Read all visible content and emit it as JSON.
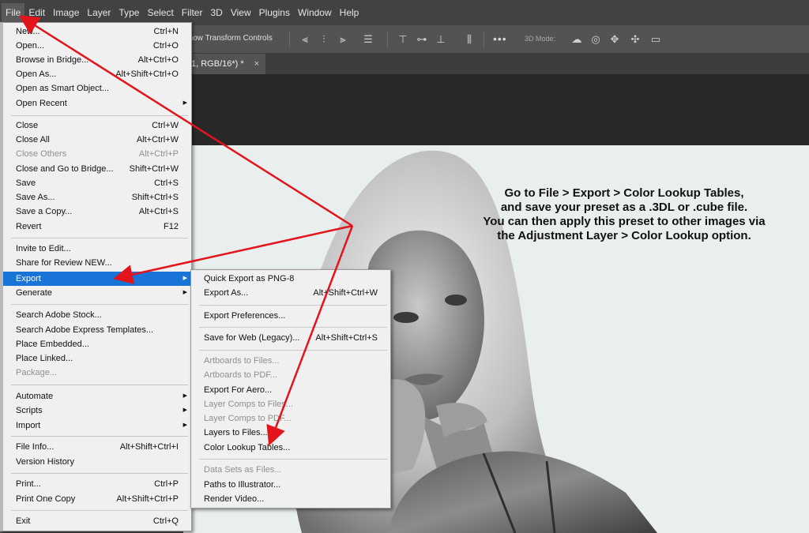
{
  "menubar": {
    "items": [
      "File",
      "Edit",
      "Image",
      "Layer",
      "Type",
      "Select",
      "Filter",
      "3D",
      "View",
      "Plugins",
      "Window",
      "Help"
    ]
  },
  "options_bar": {
    "show_transform_label": "Show Transform Controls",
    "more_label": "•••",
    "mode_3d_label": "3D Mode:"
  },
  "document_tab": {
    "title": "1, RGB/16*) *",
    "close": "×"
  },
  "annotation": {
    "lines": [
      "Go to File > Export > Color Lookup Tables,",
      "and save your preset as a .3DL or .cube file.",
      "You can then apply this preset to other images via",
      "the Adjustment Layer > Color Lookup option."
    ]
  },
  "file_menu": {
    "items": [
      {
        "label": "New...",
        "shortcut": "Ctrl+N"
      },
      {
        "label": "Open...",
        "shortcut": "Ctrl+O"
      },
      {
        "label": "Browse in Bridge...",
        "shortcut": "Alt+Ctrl+O"
      },
      {
        "label": "Open As...",
        "shortcut": "Alt+Shift+Ctrl+O"
      },
      {
        "label": "Open as Smart Object...",
        "shortcut": ""
      },
      {
        "label": "Open Recent",
        "shortcut": "",
        "submenu": true
      },
      {
        "label": "Close",
        "shortcut": "Ctrl+W"
      },
      {
        "label": "Close All",
        "shortcut": "Alt+Ctrl+W"
      },
      {
        "label": "Close Others",
        "shortcut": "Alt+Ctrl+P",
        "disabled": true
      },
      {
        "label": "Close and Go to Bridge...",
        "shortcut": "Shift+Ctrl+W"
      },
      {
        "label": "Save",
        "shortcut": "Ctrl+S"
      },
      {
        "label": "Save As...",
        "shortcut": "Shift+Ctrl+S"
      },
      {
        "label": "Save a Copy...",
        "shortcut": "Alt+Ctrl+S"
      },
      {
        "label": "Revert",
        "shortcut": "F12"
      },
      {
        "label": "Invite to Edit...",
        "shortcut": ""
      },
      {
        "label": "Share for Review NEW...",
        "shortcut": ""
      },
      {
        "label": "Export",
        "shortcut": "",
        "submenu": true,
        "highlighted": true
      },
      {
        "label": "Generate",
        "shortcut": "",
        "submenu": true
      },
      {
        "label": "Search Adobe Stock...",
        "shortcut": ""
      },
      {
        "label": "Search Adobe Express Templates...",
        "shortcut": ""
      },
      {
        "label": "Place Embedded...",
        "shortcut": ""
      },
      {
        "label": "Place Linked...",
        "shortcut": ""
      },
      {
        "label": "Package...",
        "shortcut": "",
        "disabled": true
      },
      {
        "label": "Automate",
        "shortcut": "",
        "submenu": true
      },
      {
        "label": "Scripts",
        "shortcut": "",
        "submenu": true
      },
      {
        "label": "Import",
        "shortcut": "",
        "submenu": true
      },
      {
        "label": "File Info...",
        "shortcut": "Alt+Shift+Ctrl+I"
      },
      {
        "label": "Version History",
        "shortcut": ""
      },
      {
        "label": "Print...",
        "shortcut": "Ctrl+P"
      },
      {
        "label": "Print One Copy",
        "shortcut": "Alt+Shift+Ctrl+P"
      },
      {
        "label": "Exit",
        "shortcut": "Ctrl+Q"
      }
    ]
  },
  "export_menu": {
    "items": [
      {
        "label": "Quick Export as PNG-8",
        "shortcut": ""
      },
      {
        "label": "Export As...",
        "shortcut": "Alt+Shift+Ctrl+W"
      },
      {
        "label": "Export Preferences...",
        "shortcut": ""
      },
      {
        "label": "Save for Web (Legacy)...",
        "shortcut": "Alt+Shift+Ctrl+S"
      },
      {
        "label": "Artboards to Files...",
        "shortcut": "",
        "disabled": true
      },
      {
        "label": "Artboards to PDF...",
        "shortcut": "",
        "disabled": true
      },
      {
        "label": "Export For Aero...",
        "shortcut": ""
      },
      {
        "label": "Layer Comps to Files...",
        "shortcut": "",
        "disabled": true
      },
      {
        "label": "Layer Comps to PDF...",
        "shortcut": "",
        "disabled": true
      },
      {
        "label": "Layers to Files...",
        "shortcut": ""
      },
      {
        "label": "Color Lookup Tables...",
        "shortcut": ""
      },
      {
        "label": "Data Sets as Files...",
        "shortcut": "",
        "disabled": true
      },
      {
        "label": "Paths to Illustrator...",
        "shortcut": ""
      },
      {
        "label": "Render Video...",
        "shortcut": ""
      }
    ]
  },
  "colors": {
    "highlight": "#1874d6",
    "arrow": "#e3141b"
  }
}
